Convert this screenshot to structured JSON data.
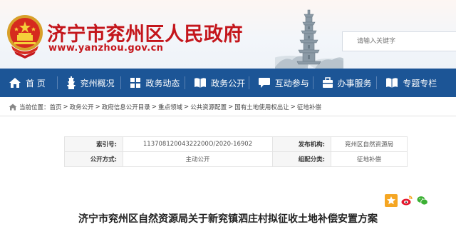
{
  "site": {
    "title": "济宁市兖州区人民政府",
    "url": "www.yanzhou.gov.cn"
  },
  "search": {
    "placeholder": "请输入关键字"
  },
  "nav": {
    "items": [
      {
        "label": "首 页",
        "icon": "home-icon"
      },
      {
        "label": "兖州概况",
        "icon": "pagoda-icon"
      },
      {
        "label": "政务动态",
        "icon": "grid-icon"
      },
      {
        "label": "政务公开",
        "icon": "book-icon"
      },
      {
        "label": "互动参与",
        "icon": "chat-icon"
      },
      {
        "label": "办事服务",
        "icon": "service-icon"
      },
      {
        "label": "专题专栏",
        "icon": "book-icon"
      }
    ]
  },
  "breadcrumb": {
    "prefix": "当前位置：",
    "items": [
      "首页",
      "政务公开",
      "政府信息公开目录",
      "重点领域",
      "公共资源配置",
      "国有土地使用权出让",
      "征地补偿"
    ],
    "separator": ">"
  },
  "meta": {
    "index_label": "索引号:",
    "index_value": "11370812004322200O/2020-16902",
    "publisher_label": "发布机构:",
    "publisher_value": "兖州区自然资源局",
    "open_label": "公开方式:",
    "open_value": "主动公开",
    "category_label": "组配分类:",
    "category_value": "征地补偿"
  },
  "article": {
    "title": "济宁市兖州区自然资源局关于新兖镇泗庄村拟征收土地补偿安置方案"
  },
  "colors": {
    "brand_red": "#c4161c",
    "nav_blue": "#1c5596"
  }
}
